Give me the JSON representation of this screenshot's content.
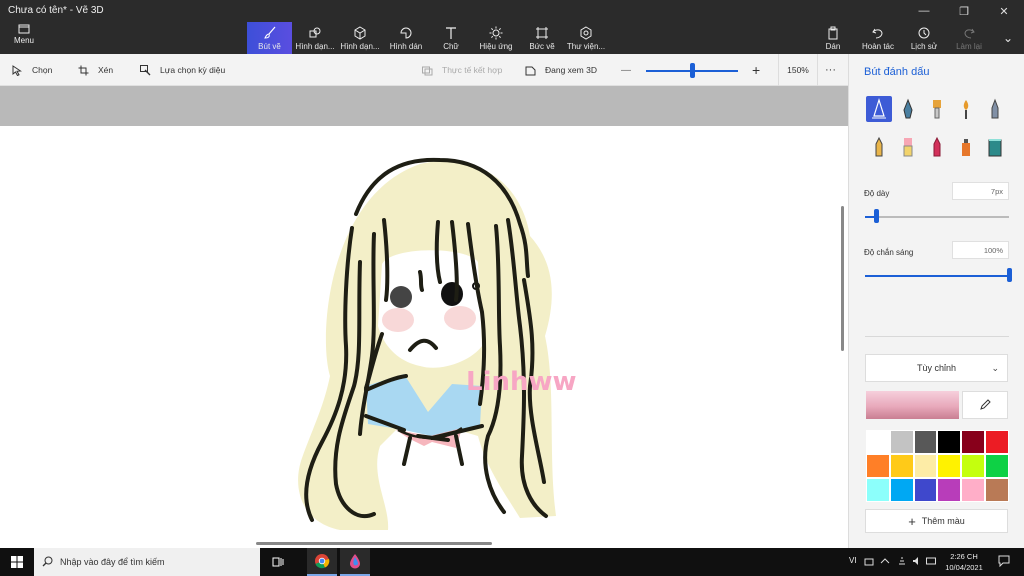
{
  "window": {
    "title": "Chưa có tên* - Vẽ 3D",
    "minimize": "—",
    "maximize": "❐",
    "close": "✕"
  },
  "ribbon": {
    "menu": "Menu",
    "tabs": [
      {
        "label": "Bút vẽ",
        "icon": "brush-icon"
      },
      {
        "label": "Hình dạn...",
        "icon": "shapes-2d-icon"
      },
      {
        "label": "Hình dạn...",
        "icon": "cube-icon"
      },
      {
        "label": "Hình dán",
        "icon": "sticker-icon"
      },
      {
        "label": "Chữ",
        "icon": "text-icon"
      },
      {
        "label": "Hiệu ứng",
        "icon": "sun-icon"
      },
      {
        "label": "Bức vẽ",
        "icon": "canvas-crop-icon"
      },
      {
        "label": "Thư viện...",
        "icon": "library-icon"
      }
    ],
    "right": [
      {
        "label": "Dán",
        "icon": "paste-icon"
      },
      {
        "label": "Hoàn tác",
        "icon": "undo-icon"
      },
      {
        "label": "Lịch sử",
        "icon": "history-icon"
      },
      {
        "label": "Làm lại",
        "icon": "redo-icon"
      }
    ],
    "more": "⌄"
  },
  "toolbar": {
    "select": "Chọn",
    "crop": "Xén",
    "magic_select": "Lựa chọn kỳ diệu",
    "mixed_reality": "Thực tế kết hợp",
    "view_3d": "Đang xem 3D",
    "zoom_out": "—",
    "zoom_in": "+",
    "zoom": "150%",
    "zoom_fraction": 0.5,
    "more": "···"
  },
  "panel": {
    "title": "Bút đánh dấu",
    "brushes": [
      "marker-icon",
      "calligraphy-pen-icon",
      "oil-brush-icon",
      "watercolor-icon",
      "pixel-pen-icon",
      "pencil-icon",
      "eraser-icon",
      "crayon-icon",
      "spray-can-icon",
      "fill-bucket-icon"
    ],
    "thickness_label": "Độ dày",
    "thickness_value": "7px",
    "thickness_fraction": 0.08,
    "opacity_label": "Độ chắn sáng",
    "opacity_value": "100%",
    "opacity_fraction": 1.0,
    "color_mode": "Tùy chỉnh",
    "current_color": "#e8a9bb",
    "swatches": [
      "#ffffff",
      "#c3c3c3",
      "#585858",
      "#000000",
      "#88001b",
      "#ec1c24",
      "#ff7f27",
      "#ffca18",
      "#fdeca6",
      "#fff200",
      "#c4ff0e",
      "#0ed145",
      "#8cfffb",
      "#00a8f3",
      "#3f48cc",
      "#b83dba",
      "#ffaec8",
      "#b97a56"
    ],
    "add_color": "Thêm màu"
  },
  "canvas": {
    "signature": "Linhww",
    "colors": {
      "hair": "#f3efc8",
      "line": "#1e1e14",
      "collar": "#a9d8f2",
      "bow": "#f6b6bd",
      "blush": "#f8d8d8",
      "signature": "#f7a6c4"
    }
  },
  "taskbar": {
    "search_placeholder": "Nhập vào đây để tìm kiếm",
    "lang": "VI",
    "time": "2:26 CH",
    "date": "10/04/2021"
  }
}
